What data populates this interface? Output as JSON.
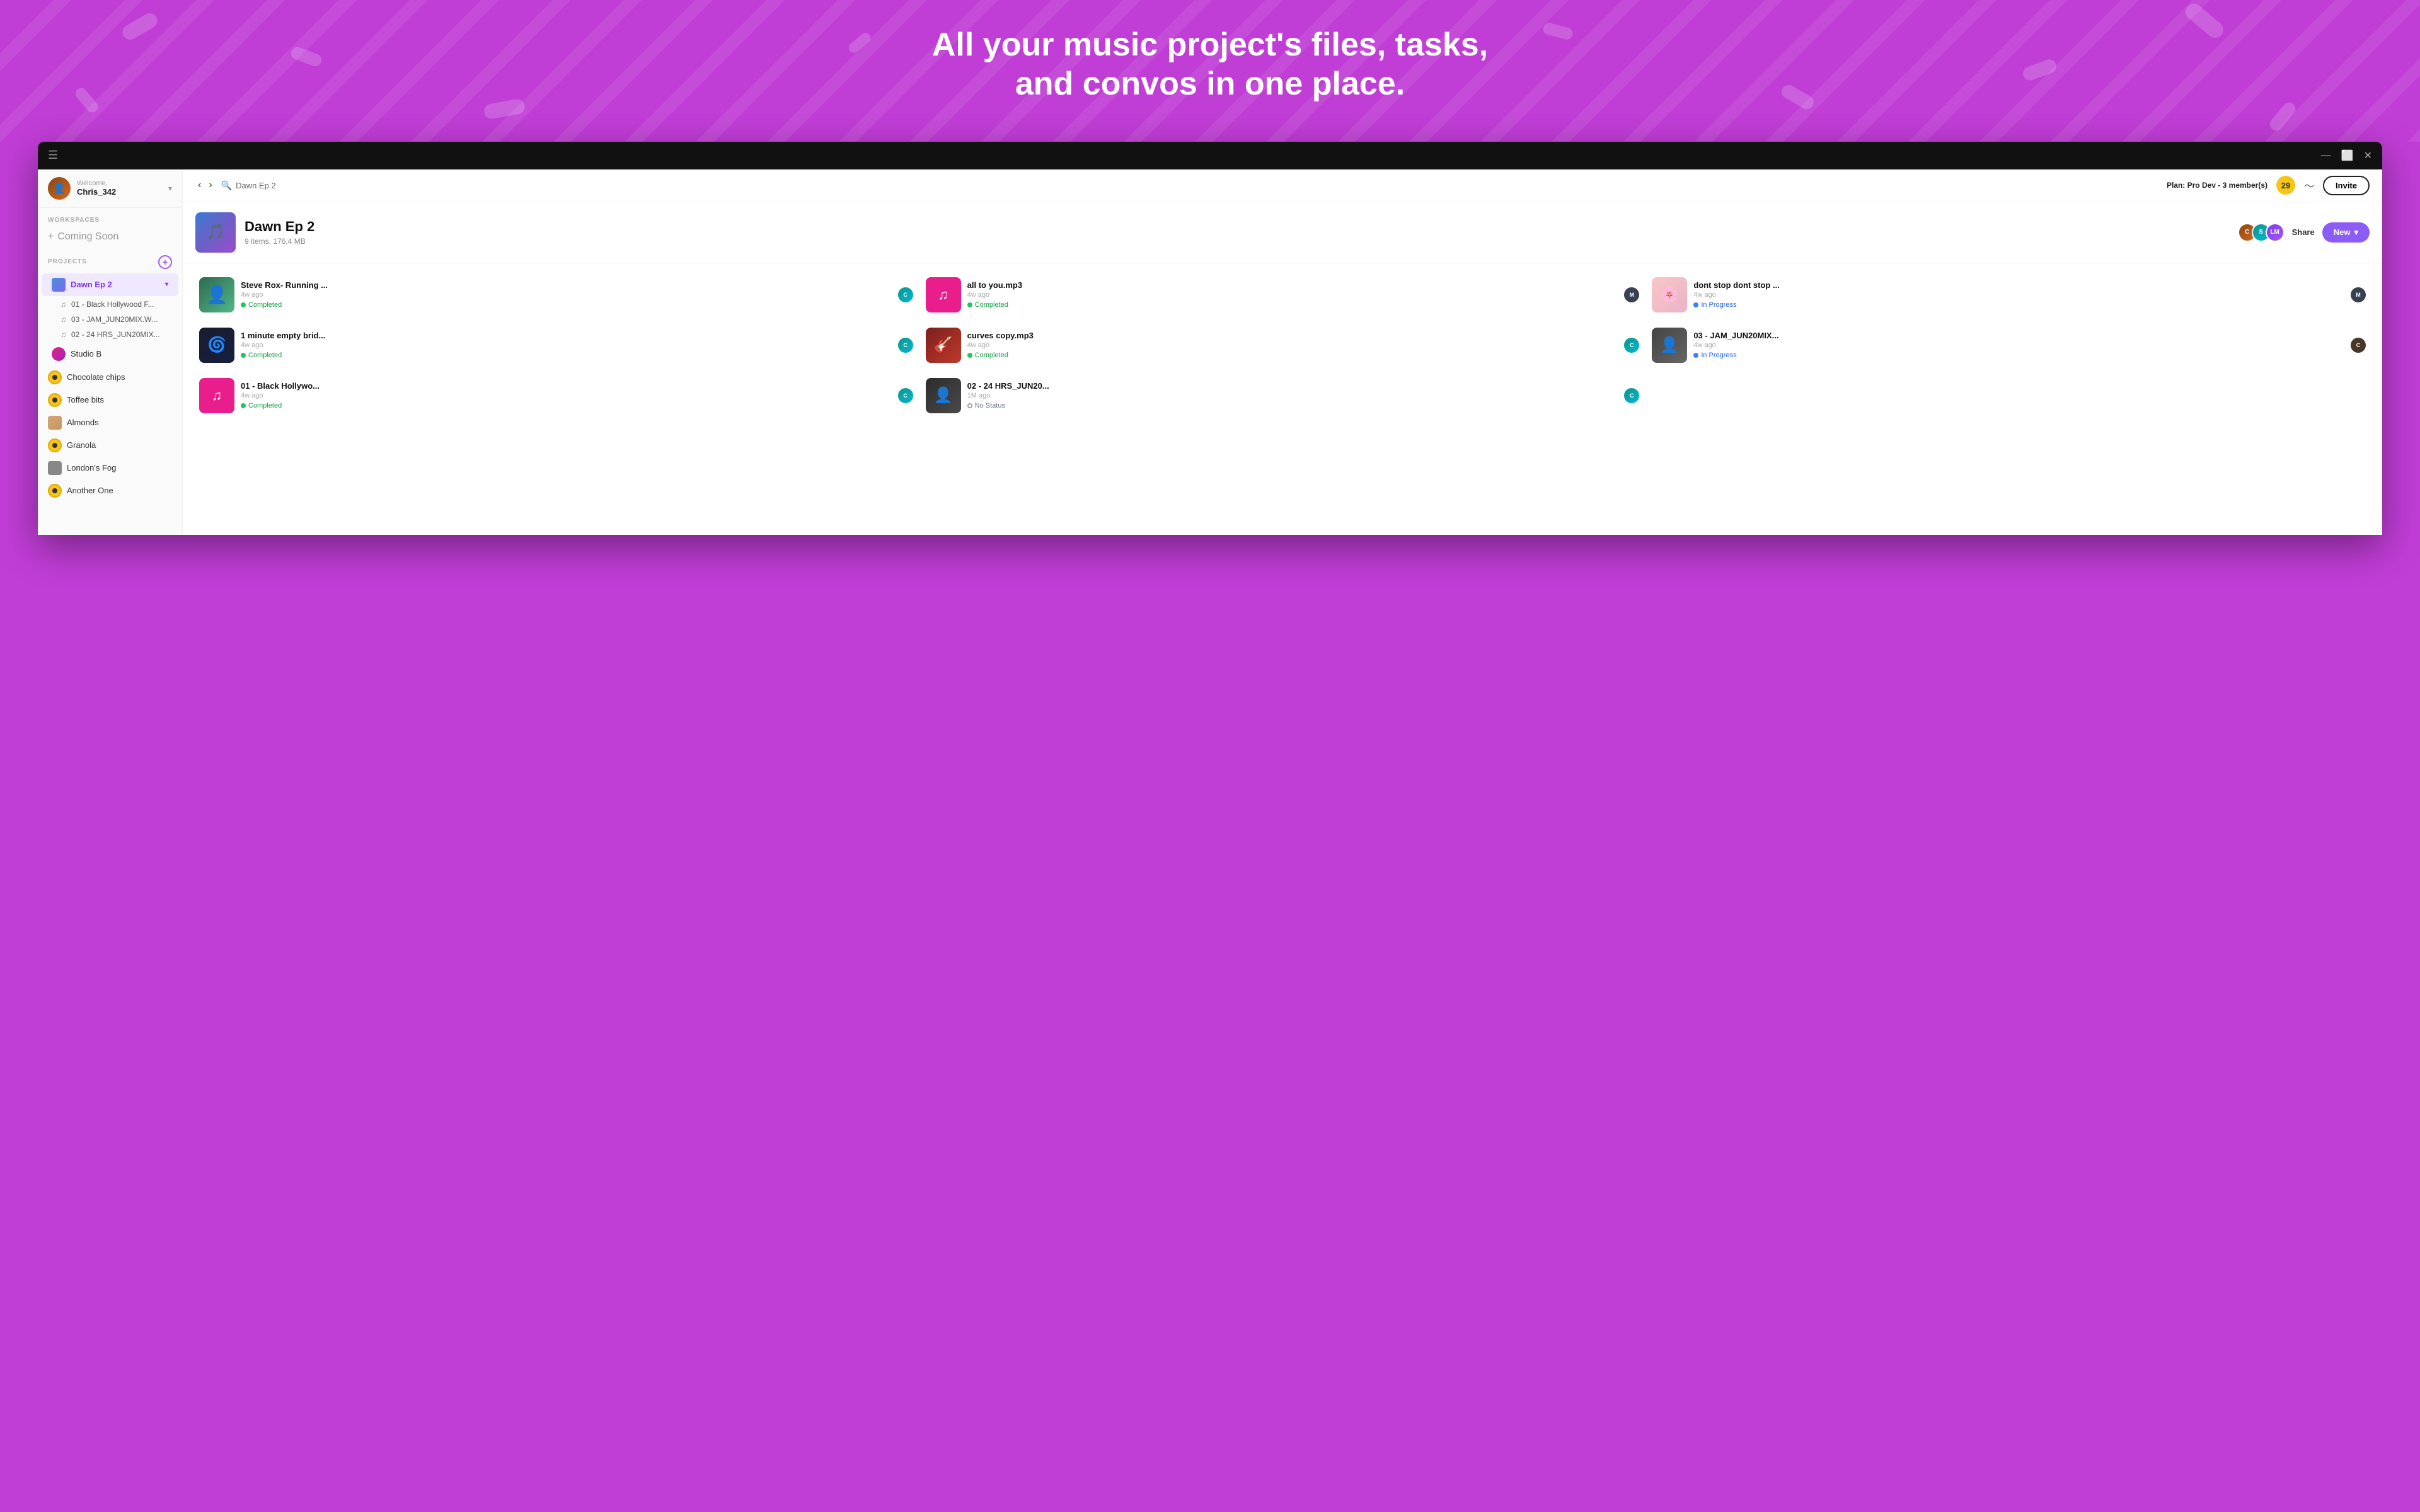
{
  "hero": {
    "title": "All your music project's files, tasks, and convos in one place."
  },
  "titlebar": {
    "menu_icon": "☰",
    "minimize": "—",
    "maximize": "⬜",
    "close": "✕"
  },
  "topbar": {
    "search_placeholder": "Dawn Ep 2",
    "plan_text": "Plan: Pro Dev - 3 member(s)",
    "notification_count": "29",
    "invite_label": "Invite"
  },
  "sidebar": {
    "welcome_label": "Welcome,",
    "username": "Chris_342",
    "workspaces_label": "WORKSPACES",
    "coming_soon": "Coming Soon",
    "projects_label": "PROJECTS",
    "active_project": "Dawn Ep 2",
    "project_items": [
      {
        "name": "Dawn Ep 2",
        "type": "project",
        "active": true
      },
      {
        "name": "01 - Black Hollywood F...",
        "type": "subitem"
      },
      {
        "name": "03 - JAM_JUN20MIX.W...",
        "type": "subitem"
      },
      {
        "name": "02 - 24 HRS_JUN20MIX...",
        "type": "subitem"
      },
      {
        "name": "Studio B",
        "type": "project"
      },
      {
        "name": "Chocolate chips",
        "type": "project"
      },
      {
        "name": "Toffee bits",
        "type": "project"
      },
      {
        "name": "Almonds",
        "type": "project"
      },
      {
        "name": "Granola",
        "type": "project"
      },
      {
        "name": "London's Fog",
        "type": "project"
      },
      {
        "name": "Another One",
        "type": "project"
      }
    ]
  },
  "project": {
    "name": "Dawn Ep 2",
    "meta": "9 items, 176.4 MB",
    "share_label": "Share",
    "new_label": "New"
  },
  "files": [
    {
      "name": "Steve Rox- Running ...",
      "time": "4w ago",
      "status": "Completed",
      "status_type": "green",
      "thumb_type": "photo",
      "thumb_color": "#2d6a4f"
    },
    {
      "name": "all to you.mp3",
      "time": "4w ago",
      "status": "Completed",
      "status_type": "green",
      "thumb_type": "music",
      "thumb_color": "#e91e8c"
    },
    {
      "name": "dont stop dont stop ...",
      "time": "4w ago",
      "status": "In Progress",
      "status_type": "blue",
      "thumb_type": "photo",
      "thumb_color": "#f0c0c0"
    },
    {
      "name": "1 minute empty brid...",
      "time": "4w ago",
      "status": "Completed",
      "status_type": "green",
      "thumb_type": "photo",
      "thumb_color": "#1a1a2e"
    },
    {
      "name": "curves copy.mp3",
      "time": "4w ago",
      "status": "Completed",
      "status_type": "green",
      "thumb_type": "photo",
      "thumb_color": "#7b1f1f"
    },
    {
      "name": "03 - JAM_JUN20MIX...",
      "time": "4w ago",
      "status": "In Progress",
      "status_type": "blue",
      "thumb_type": "photo",
      "thumb_color": "#555"
    },
    {
      "name": "01 - Black Hollywo...",
      "time": "4w ago",
      "status": "Completed",
      "status_type": "green",
      "thumb_type": "music",
      "thumb_color": "#e91e8c"
    },
    {
      "name": "02 - 24 HRS_JUN20...",
      "time": "1M ago",
      "status": "No Status",
      "status_type": "gray",
      "thumb_type": "photo",
      "thumb_color": "#3a3a3a"
    }
  ]
}
